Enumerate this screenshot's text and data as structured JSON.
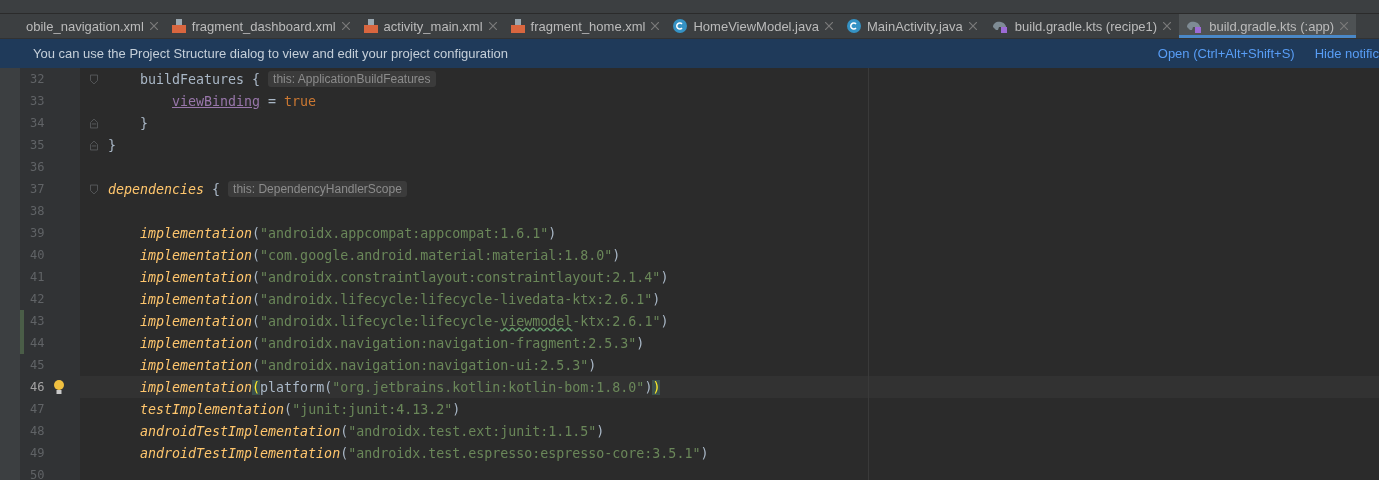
{
  "tabs": [
    {
      "label": "obile_navigation.xml",
      "selected": false
    },
    {
      "label": "fragment_dashboard.xml",
      "kind": "xml",
      "selected": false
    },
    {
      "label": "activity_main.xml",
      "kind": "xml",
      "selected": false
    },
    {
      "label": "fragment_home.xml",
      "kind": "xml",
      "selected": false
    },
    {
      "label": "HomeViewModel.java",
      "kind": "java",
      "selected": false
    },
    {
      "label": "MainActivity.java",
      "kind": "java",
      "selected": false
    },
    {
      "label": "build.gradle.kts (recipe1)",
      "kind": "gradle",
      "selected": false
    },
    {
      "label": "build.gradle.kts (:app)",
      "kind": "gradle",
      "selected": true
    }
  ],
  "banner": {
    "message": "You can use the Project Structure dialog to view and edit your project configuration",
    "links": [
      "Open (Ctrl+Alt+Shift+S)",
      "Hide notific"
    ]
  },
  "lines": [
    {
      "children": [
        {
          "number": "32",
          "current": false,
          "changed": false,
          "bulb": false,
          "tokens": [
            {
              "kind": "plain",
              "text": "buildFeatures {"
            }
          ],
          "hint": "this: ApplicationBuildFeatures",
          "children": [
            {
              "number": "33",
              "current": false,
              "changed": false,
              "bulb": false,
              "tokens": [
                {
                  "kind": "property",
                  "text": "viewBinding"
                },
                {
                  "kind": "plain",
                  "text": " = "
                },
                {
                  "kind": "keyword",
                  "text": "true"
                }
              ]
            }
          ]
        },
        {
          "number": "34",
          "current": false,
          "changed": false,
          "bulb": false,
          "tokens": [
            {
              "kind": "close",
              "text": "}"
            }
          ]
        }
      ]
    },
    {
      "number": "35",
      "current": false,
      "changed": false,
      "bulb": false,
      "tokens": [
        {
          "kind": "close",
          "text": "}"
        }
      ]
    },
    {
      "number": "36",
      "current": false,
      "changed": false,
      "bulb": false
    },
    {
      "number": "37",
      "current": false,
      "changed": false,
      "bulb": false,
      "tokens": [
        {
          "kind": "call",
          "text": "dependencies"
        },
        {
          "kind": "plain",
          "text": " {"
        }
      ],
      "hint": "this: DependencyHandlerScope",
      "children": [
        {
          "number": "38",
          "current": false,
          "changed": false,
          "bulb": false
        },
        {
          "number": "39",
          "current": false,
          "changed": false,
          "bulb": false,
          "tokens": [
            {
              "kind": "call",
              "text": "implementation"
            },
            {
              "kind": "plain",
              "text": "("
            },
            {
              "kind": "string",
              "text": "\"androidx.appcompat:appcompat:1.6.1\""
            },
            {
              "kind": "plain",
              "text": ")"
            }
          ]
        },
        {
          "number": "40",
          "current": false,
          "changed": false,
          "bulb": false,
          "tokens": [
            {
              "kind": "call",
              "text": "implementation"
            },
            {
              "kind": "plain",
              "text": "("
            },
            {
              "kind": "string",
              "text": "\"com.google.android.material:material:1.8.0\""
            },
            {
              "kind": "plain",
              "text": ")"
            }
          ]
        },
        {
          "number": "41",
          "current": false,
          "changed": false,
          "bulb": false,
          "tokens": [
            {
              "kind": "call",
              "text": "implementation"
            },
            {
              "kind": "plain",
              "text": "("
            },
            {
              "kind": "string",
              "text": "\"androidx.constraintlayout:constraintlayout:2.1.4\""
            },
            {
              "kind": "plain",
              "text": ")"
            }
          ]
        },
        {
          "number": "42",
          "current": false,
          "changed": false,
          "bulb": false,
          "tokens": [
            {
              "kind": "call",
              "text": "implementation"
            },
            {
              "kind": "plain",
              "text": "("
            },
            {
              "kind": "string",
              "text": "\"androidx.lifecycle:lifecycle-livedata-ktx:2.6.1\""
            },
            {
              "kind": "plain",
              "text": ")"
            }
          ]
        },
        {
          "number": "43",
          "current": false,
          "changed": true,
          "bulb": false,
          "tokens": [
            {
              "kind": "call",
              "text": "implementation"
            },
            {
              "kind": "plain",
              "text": "("
            },
            {
              "kind": "string",
              "text": "\"androidx.lifecycle:lifecycle-"
            },
            {
              "kind": "typo",
              "text": "viewmodel"
            },
            {
              "kind": "string",
              "text": "-ktx:2.6.1\""
            },
            {
              "kind": "plain",
              "text": ")"
            }
          ]
        },
        {
          "number": "44",
          "current": false,
          "changed": true,
          "bulb": false,
          "tokens": [
            {
              "kind": "call",
              "text": "implementation"
            },
            {
              "kind": "plain",
              "text": "("
            },
            {
              "kind": "string",
              "text": "\"androidx.navigation:navigation-fragment:2.5.3\""
            },
            {
              "kind": "plain",
              "text": ")"
            }
          ]
        },
        {
          "number": "45",
          "current": false,
          "changed": false,
          "bulb": false,
          "tokens": [
            {
              "kind": "call",
              "text": "implementation"
            },
            {
              "kind": "plain",
              "text": "("
            },
            {
              "kind": "string",
              "text": "\"androidx.navigation:navigation-ui:2.5.3\""
            },
            {
              "kind": "plain",
              "text": ")"
            }
          ]
        },
        {
          "number": "46",
          "current": true,
          "changed": false,
          "bulb": true,
          "tokens": [
            {
              "kind": "call",
              "text": "implementation"
            },
            {
              "kind": "match",
              "text": "("
            },
            {
              "kind": "plain",
              "text": "platform("
            },
            {
              "kind": "string",
              "text": "\"org.jetbrains.kotlin:kotlin-bom:1.8.0\""
            },
            {
              "kind": "plain",
              "text": ")"
            },
            {
              "kind": "match",
              "text": ")"
            }
          ]
        },
        {
          "number": "47",
          "current": false,
          "changed": false,
          "bulb": false,
          "tokens": [
            {
              "kind": "call",
              "text": "testImplementation"
            },
            {
              "kind": "plain",
              "text": "("
            },
            {
              "kind": "string",
              "text": "\"junit:junit:4.13.2\""
            },
            {
              "kind": "plain",
              "text": ")"
            }
          ]
        },
        {
          "number": "48",
          "current": false,
          "changed": false,
          "bulb": false,
          "tokens": [
            {
              "kind": "call",
              "text": "androidTestImplementation"
            },
            {
              "kind": "plain",
              "text": "("
            },
            {
              "kind": "string",
              "text": "\"androidx.test.ext:junit:1.1.5\""
            },
            {
              "kind": "plain",
              "text": ")"
            }
          ]
        },
        {
          "number": "49",
          "current": false,
          "changed": false,
          "bulb": false,
          "tokens": [
            {
              "kind": "call",
              "text": "androidTestImplementation"
            },
            {
              "kind": "plain",
              "text": "("
            },
            {
              "kind": "string",
              "text": "\"androidx.test.espresso:espresso-core:3.5.1\""
            },
            {
              "kind": "plain",
              "text": ")"
            }
          ]
        },
        {
          "number": "50",
          "current": false,
          "changed": false,
          "bulb": false
        }
      ]
    }
  ]
}
